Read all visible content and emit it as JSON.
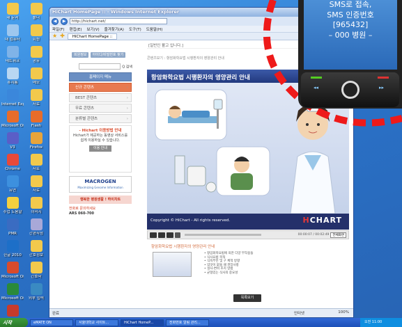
{
  "desktop": {
    "icons": [
      {
        "label": "내 문서",
        "color": "#f2c94c"
      },
      {
        "label": "내 컴퓨터",
        "color": "#9ec7ee"
      },
      {
        "label": "네트워크",
        "color": "#7fb3e8"
      },
      {
        "label": "휴지통",
        "color": "#b9d7f2"
      },
      {
        "label": "Internet Explorer",
        "color": "#3b87db"
      },
      {
        "label": "Microsoft Office",
        "color": "#e86c2a"
      },
      {
        "label": "V3",
        "color": "#5a5ec7"
      },
      {
        "label": "Chrome",
        "color": "#e8493a"
      },
      {
        "label": "유연",
        "color": "#3d90de"
      },
      {
        "label": "수업 도움말",
        "color": "#f4d03f"
      },
      {
        "label": "PMR",
        "color": "#3a6cc2"
      },
      {
        "label": "한글 2010",
        "color": "#1d6fc8"
      },
      {
        "label": "Microsoft Office",
        "color": "#d84b2c"
      },
      {
        "label": "Microsoft Office",
        "color": "#2a8a3a"
      },
      {
        "label": "Microsoft Office",
        "color": "#c73b2c"
      }
    ],
    "right_icons": [
      {
        "label": "폴더",
        "color": "#f2c94c"
      },
      {
        "label": "회원",
        "color": "#f2c94c"
      },
      {
        "label": "공유",
        "color": "#f2c94c"
      },
      {
        "label": "메모",
        "color": "#f2c94c"
      },
      {
        "label": "자료",
        "color": "#f2c94c"
      },
      {
        "label": "Flash",
        "color": "#e86c2a"
      },
      {
        "label": "Firefox",
        "color": "#e8a43a"
      },
      {
        "label": "자료",
        "color": "#f2c94c"
      },
      {
        "label": "자료",
        "color": "#f2c94c"
      },
      {
        "label": "이미지",
        "color": "#f2c94c"
      },
      {
        "label": "간편작성",
        "color": "#a8a8d8"
      },
      {
        "label": "간호정보",
        "color": "#f2c94c"
      },
      {
        "label": "간호학",
        "color": "#f2c94c"
      },
      {
        "label": "외부 입력",
        "color": "#3a8ac2"
      }
    ]
  },
  "ie": {
    "title": "HiChart HomePage :: - Windows Internet Explorer",
    "url": "http://hichart.net/",
    "menu": [
      "파일(F)",
      "편집(E)",
      "보기(V)",
      "즐겨찾기(A)",
      "도구(T)",
      "도움말(H)"
    ],
    "tab": "HiChart HomePage ::",
    "status_left": "완료",
    "status_zone": "인터넷",
    "status_zoom": "100%"
  },
  "page": {
    "left": {
      "search_label": "Q 검색",
      "small_btns": [
        "회원정보",
        "아이디/비밀번호 찾기"
      ],
      "section_label": "홈페이지 메뉴",
      "menu": [
        {
          "label": "신규 콘텐츠",
          "active": true
        },
        {
          "label": "BEST 콘텐츠",
          "active": false
        },
        {
          "label": "무료 콘텐츠",
          "active": false
        },
        {
          "label": "분류별 콘텐츠",
          "active": false
        }
      ],
      "promo_title": "- Hichart 이용방법 안내",
      "promo_body": "Hichart가 제공하는 동영상 서비스를 쉽게 이용하실 수 있습니다.",
      "promo_btn": "이용 안내",
      "macrogen_name": "MACROGEN",
      "macrogen_sub": "Maximizing Genome Information",
      "red_banner": "행복한 병원생활 ! 하이차트",
      "ars_label": "전화로 문의하세요",
      "ars_number": "ARS 060-700"
    },
    "main": {
      "top_note": "[일반인 활고 입니다.]",
      "breadcrumb": "콘텐츠보기 : 항암화학요법 시행환자의 영양관리 안내",
      "player_title": "항암화학요법 시행환자의 영양관리 안내",
      "copyright": "Copyright © HiChart - All rights reserved.",
      "logo_h": "H",
      "logo_rest": "CHART",
      "time": "00:00:07 / 00:02:49",
      "fullscreen": "전체화면",
      "info_title": "항암화학요법 시행환자의 영양관리 안내",
      "bullets": [
        "• 항암화학요법에 의한 다양 부작용들",
        "• 식사요법 목적",
        "• 식욕부진 및 구 체적 방향",
        "• 입맛이 없을 때 권장사항",
        "• 설사·변비 조치 방법",
        "• 균형있는 식사의 중요성"
      ],
      "close_btn": "목록보기"
    }
  },
  "phone": {
    "lines": [
      "SMS로 접속,",
      "SMS 인증번호",
      "[965432]",
      "– 000 병원 –"
    ]
  },
  "taskbar": {
    "start": "시작",
    "items": [
      "eMATE ON",
      "서울대학교 사이트...",
      "HiChart HomeP...",
      "전화번호 알림 관리..."
    ],
    "tray": "오전 11:00"
  }
}
